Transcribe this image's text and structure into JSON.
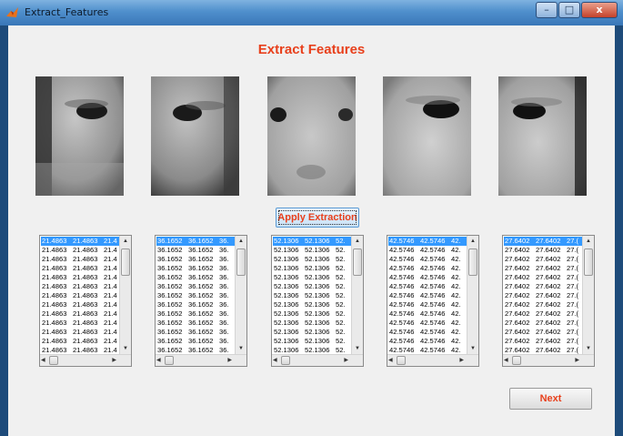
{
  "window": {
    "title": "Extract_Features",
    "minimize": "–",
    "maximize": "□",
    "close": "x"
  },
  "heading": "Extract Features",
  "apply_button": "Apply Extraction",
  "next_button": "Next",
  "colors": {
    "heading": "#e8401c",
    "selection": "#3399ff",
    "titlebar": "#4f8fcc"
  },
  "faces": [
    {
      "region": "left eye close-up"
    },
    {
      "region": "right eye close-up"
    },
    {
      "region": "nose bridge close-up"
    },
    {
      "region": "left eye close-up"
    },
    {
      "region": "right eye close-up"
    }
  ],
  "lists": [
    {
      "col1": "21.4863",
      "col2": "21.4863",
      "col3": "21.4"
    },
    {
      "col1": "36.1652",
      "col2": "36.1652",
      "col3": "36."
    },
    {
      "col1": "52.1306",
      "col2": "52.1306",
      "col3": "52."
    },
    {
      "col1": "42.5746",
      "col2": "42.5746",
      "col3": "42."
    },
    {
      "col1": "27.6402",
      "col2": "27.6402",
      "col3": "27.("
    }
  ],
  "rows_per_list": 13
}
